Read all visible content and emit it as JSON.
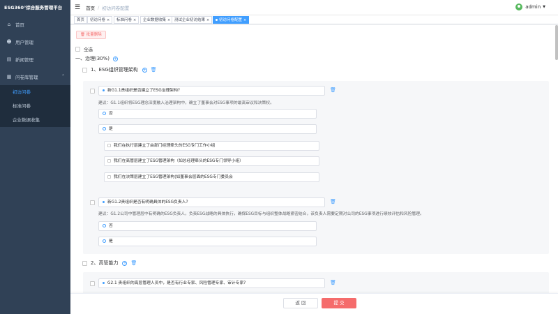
{
  "app": {
    "title": "ESG360°综合服务管理平台"
  },
  "sidebar": {
    "items": [
      {
        "label": "首页",
        "icon": "home-icon"
      },
      {
        "label": "用户管理",
        "icon": "user-icon"
      },
      {
        "label": "新闻管理",
        "icon": "document-icon"
      },
      {
        "label": "问卷库管理",
        "icon": "folder-icon"
      }
    ],
    "submenu": [
      {
        "label": "初访问卷",
        "active": true
      },
      {
        "label": "标准问卷",
        "active": false
      },
      {
        "label": "企业数据收集",
        "active": false
      }
    ]
  },
  "header": {
    "breadcrumb": [
      "首页",
      "初访问卷配置"
    ],
    "user": "admin"
  },
  "tags": [
    {
      "label": "首页",
      "closable": false,
      "active": false
    },
    {
      "label": "初访问卷",
      "closable": true,
      "active": false
    },
    {
      "label": "标准问卷",
      "closable": true,
      "active": false
    },
    {
      "label": "企业数据收集",
      "closable": true,
      "active": false
    },
    {
      "label": "测试企业初访结果",
      "closable": true,
      "active": false
    },
    {
      "label": "初访问卷配置",
      "closable": true,
      "active": true
    }
  ],
  "toolbar": {
    "batch_delete": "批量删除",
    "select_all": "全选"
  },
  "section1": {
    "title": "一、治理(30%)",
    "sub1": {
      "title": "1、ESG组织管理架构",
      "q1": {
        "text": "新G1.1贵组织是否建立了ESG治理架构?",
        "tip": "建议：G1.1组织将ESG理念深度融入治理架构中，确立了董事会对ESG事项的最高审议和决策权。",
        "options": [
          "否",
          "是"
        ],
        "suboptions": [
          "我们在执行层建立了由部门经理牵头的ESG专门工作小组",
          "我们在高管层建立了ESG管理架构（如总经理牵头的ESG专门领导小组）",
          "我们在决策层建立了ESG管理架构(如董事会层面的ESG专门委员会"
        ]
      },
      "q2": {
        "text": "新G1.2贵组织是否有明确具体的ESG负责人?",
        "tip": "建议：G1.2公司中管理层中有明确的ESG负责人，负责ESG战略的具体执行，确保ESG目标与组织整体战略紧密结合，该负责人需要定期对公司的ESG事项进行绩效评估和风险管理。",
        "options": [
          "否",
          "是"
        ]
      }
    },
    "sub2": {
      "title": "2、高管能力",
      "q1": {
        "text": "G2.1 贵组织的高层管理人员中，是否有行业专家、风险管理专家、审计专家?"
      }
    }
  },
  "footer": {
    "back": "返 回",
    "submit": "提 交"
  }
}
